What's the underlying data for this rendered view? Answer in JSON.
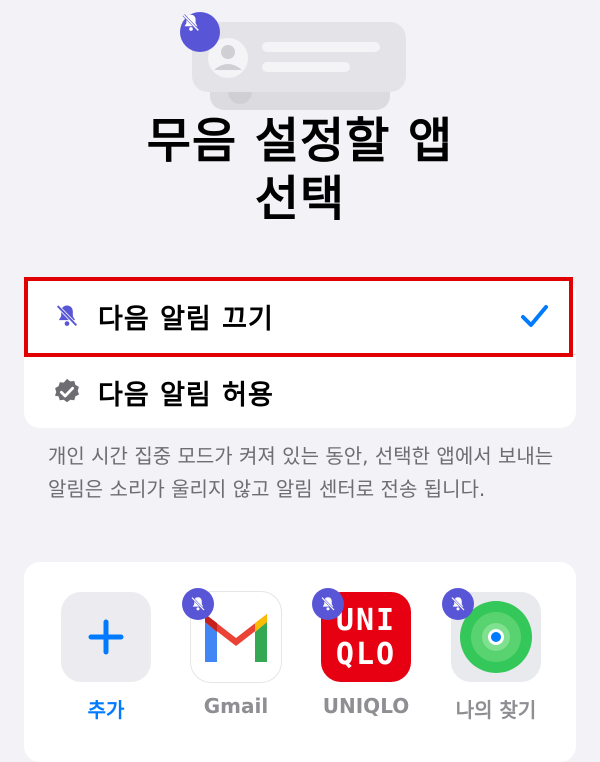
{
  "title_line1": "무음 설정할 앱",
  "title_line2": "선택",
  "options": {
    "silence_label": "다음 알림 끄기",
    "allow_label": "다음 알림 허용"
  },
  "description": "개인 시간 집중 모드가 켜져 있는 동안, 선택한 앱에서 보내는 알림은 소리가 울리지 않고 알림 센터로 전송 됩니다.",
  "apps": {
    "add_label": "추가",
    "gmail_label": "Gmail",
    "uniqlo_label": "UNIQLO",
    "uniqlo_logo_line1": "UNI",
    "uniqlo_logo_line2": "QLO",
    "findmy_label": "나의 찾기"
  },
  "colors": {
    "accent": "#007aff",
    "badge": "#5856d6",
    "highlight": "#e00000",
    "uniqlo_red": "#e60012"
  },
  "icons": [
    "bell-slash-icon",
    "checkmark-icon",
    "verified-badge-icon",
    "plus-icon"
  ]
}
